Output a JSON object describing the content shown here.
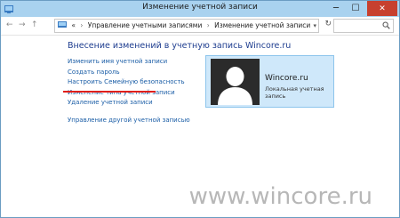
{
  "window": {
    "title": "Изменение учетной записи",
    "min_symbol": "─",
    "max_symbol": "☐",
    "close_symbol": "✕"
  },
  "nav": {
    "back": "←",
    "forward": "→",
    "up": "↑"
  },
  "address": {
    "prefix": "«",
    "crumbs": [
      "Управление учетными записями",
      "Изменение учетной записи"
    ],
    "separator": "›",
    "dropdown": "▾",
    "refresh": "↻"
  },
  "main": {
    "heading": "Внесение изменений в учетную запись Wincore.ru",
    "links": [
      "Изменить имя учетной записи",
      "Создать пароль",
      "Настроить Семейную безопасность",
      "Изменение типа учетной записи",
      "Удаление учетной записи"
    ],
    "other_link": "Управление другой учетной записью"
  },
  "account": {
    "name": "Wincore.ru",
    "type": "Локальная учетная запись"
  },
  "watermark": "www.wincore.ru",
  "colors": {
    "titlebar": "#a9d2ef",
    "link": "#1a5da6",
    "heading": "#1e3d8f",
    "close_button": "#c7402f",
    "highlight_line": "#e0201b",
    "card_bg": "#cfe8fa"
  }
}
